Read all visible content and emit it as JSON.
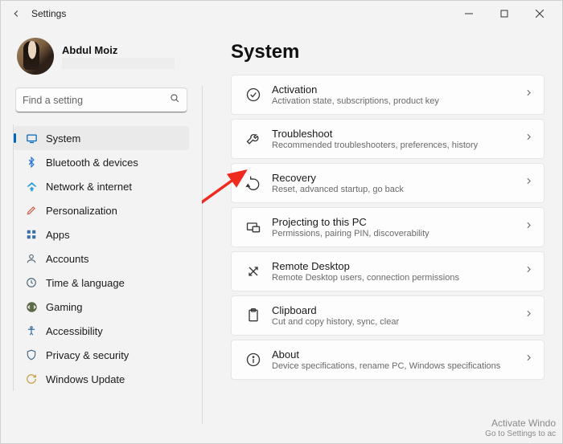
{
  "titlebar": {
    "title": "Settings"
  },
  "profile": {
    "name": "Abdul Moiz"
  },
  "search": {
    "placeholder": "Find a setting"
  },
  "nav": [
    {
      "id": "system",
      "label": "System",
      "active": true
    },
    {
      "id": "bluetooth",
      "label": "Bluetooth & devices"
    },
    {
      "id": "network",
      "label": "Network & internet"
    },
    {
      "id": "personalization",
      "label": "Personalization"
    },
    {
      "id": "apps",
      "label": "Apps"
    },
    {
      "id": "accounts",
      "label": "Accounts"
    },
    {
      "id": "time",
      "label": "Time & language"
    },
    {
      "id": "gaming",
      "label": "Gaming"
    },
    {
      "id": "accessibility",
      "label": "Accessibility"
    },
    {
      "id": "privacy",
      "label": "Privacy & security"
    },
    {
      "id": "update",
      "label": "Windows Update"
    }
  ],
  "page": {
    "title": "System"
  },
  "cards": [
    {
      "id": "activation",
      "title": "Activation",
      "sub": "Activation state, subscriptions, product key"
    },
    {
      "id": "troubleshoot",
      "title": "Troubleshoot",
      "sub": "Recommended troubleshooters, preferences, history"
    },
    {
      "id": "recovery",
      "title": "Recovery",
      "sub": "Reset, advanced startup, go back"
    },
    {
      "id": "projecting",
      "title": "Projecting to this PC",
      "sub": "Permissions, pairing PIN, discoverability"
    },
    {
      "id": "remotedesktop",
      "title": "Remote Desktop",
      "sub": "Remote Desktop users, connection permissions"
    },
    {
      "id": "clipboard",
      "title": "Clipboard",
      "sub": "Cut and copy history, sync, clear"
    },
    {
      "id": "about",
      "title": "About",
      "sub": "Device specifications, rename PC, Windows specifications"
    }
  ],
  "watermark": {
    "line1": "Activate Windo",
    "line2": "Go to Settings to ac"
  }
}
